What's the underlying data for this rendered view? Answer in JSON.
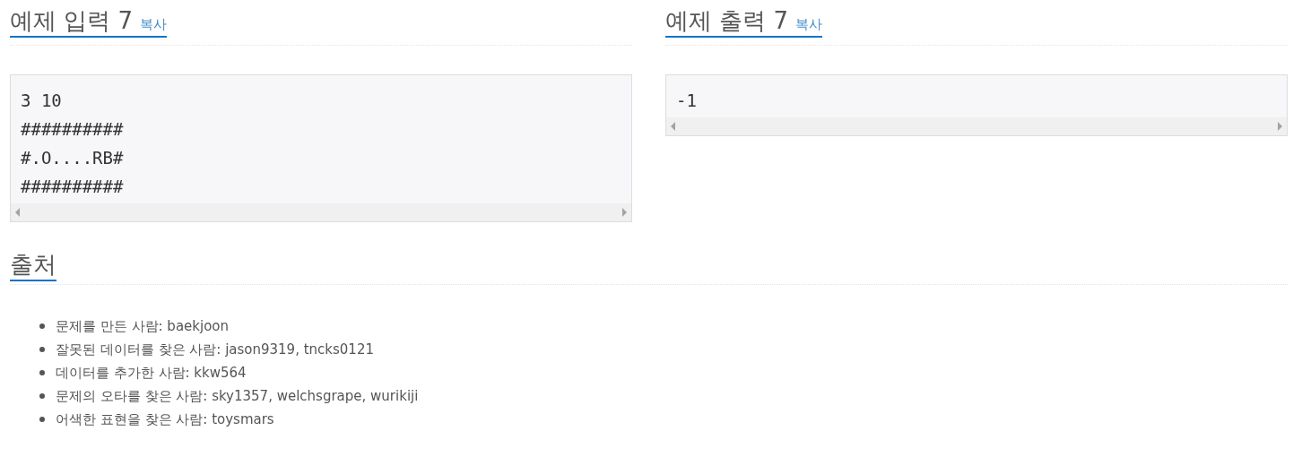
{
  "samples": [
    {
      "title": "예제 입력 7",
      "copy": "복사",
      "lines": [
        "3 10",
        "##########",
        "#.O....RB#",
        "##########"
      ]
    },
    {
      "title": "예제 출력 7",
      "copy": "복사",
      "lines": [
        "-1"
      ]
    }
  ],
  "source": {
    "title": "출처",
    "items": [
      "문제를 만든 사람: baekjoon",
      "잘못된 데이터를 찾은 사람: jason9319, tncks0121",
      "데이터를 추가한 사람: kkw564",
      "문제의 오타를 찾은 사람: sky1357, welchsgrape, wurikiji",
      "어색한 표현을 찾은 사람: toysmars"
    ]
  }
}
